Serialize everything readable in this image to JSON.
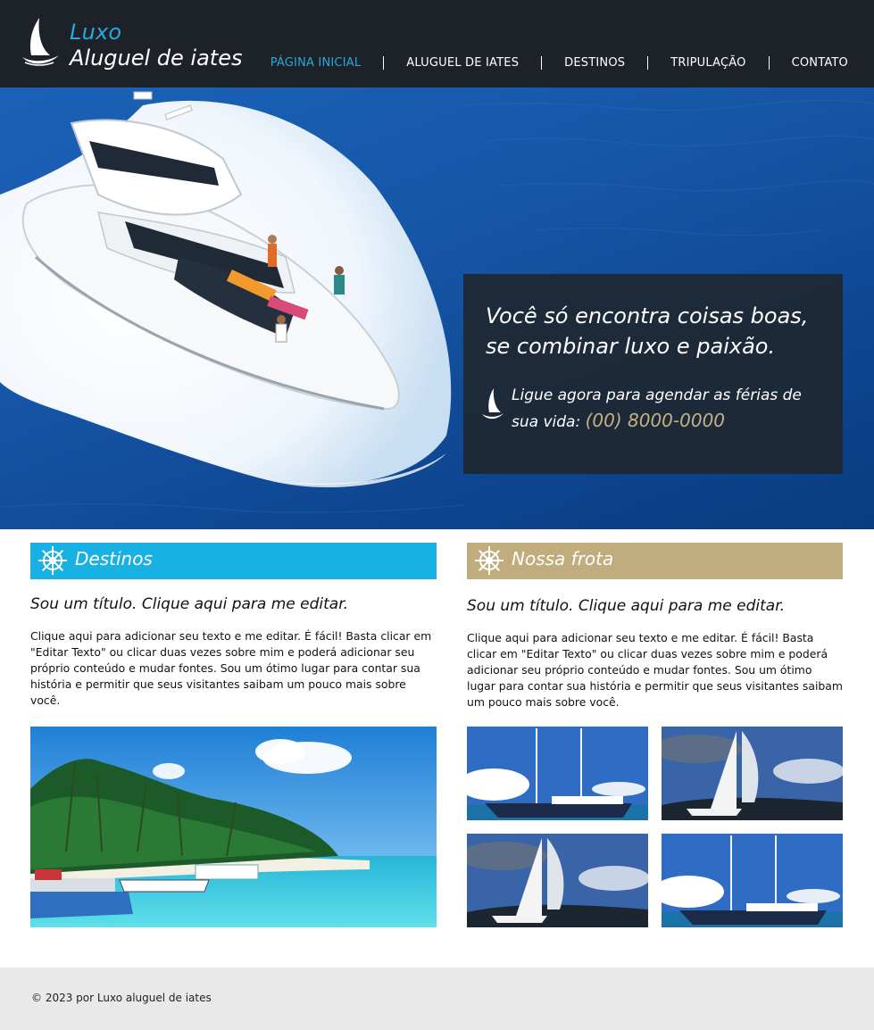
{
  "header": {
    "logo_line1": "Luxo",
    "logo_line2": "Aluguel de iates",
    "nav": [
      {
        "label": "PÁGINA INICIAL",
        "active": true
      },
      {
        "label": "ALUGUEL DE IATES",
        "active": false
      },
      {
        "label": "DESTINOS",
        "active": false
      },
      {
        "label": "TRIPULAÇÃO",
        "active": false
      },
      {
        "label": "CONTATO",
        "active": false
      }
    ]
  },
  "hero": {
    "title_line1": "Você só encontra coisas boas,",
    "title_line2": "se combinar luxo e paixão.",
    "call_line1": "Ligue agora para agendar as férias de",
    "call_prefix": "sua vida:",
    "phone": "(00) 8000-0000"
  },
  "left_section": {
    "heading": "Destinos",
    "post_title": "Sou um título. Clique aqui para me editar.",
    "post_text": "Clique aqui para adicionar seu texto e me editar. É fácil! Basta clicar em \"Editar Texto\" ou clicar duas vezes sobre mim e poderá adicionar seu próprio conteúdo e mudar fontes. Sou um ótimo lugar para contar sua história e permitir que seus visitantes saibam um pouco mais sobre você."
  },
  "right_section": {
    "heading": "Nossa frota",
    "post_title": "Sou um título. Clique aqui para me editar.",
    "post_text": "Clique aqui para adicionar seu texto e me editar. É fácil! Basta clicar em \"Editar Texto\" ou clicar duas vezes sobre mim e poderá adicionar seu próprio conteúdo e mudar fontes. Sou um ótimo lugar para contar sua história e permitir que seus visitantes saibam um pouco mais sobre você."
  },
  "footer": {
    "copyright": "© 2023 por Luxo aluguel de iates"
  },
  "colors": {
    "header_bg": "#1d2228",
    "accent_blue": "#19b0e4",
    "accent_gold": "#c0ac7c",
    "phone_gold": "#c4b083",
    "footer_bg": "#e9e9e9"
  },
  "icons": {
    "logo": "sailboat-icon",
    "hero": "sailboat-icon",
    "section": "ship-wheel-icon"
  }
}
